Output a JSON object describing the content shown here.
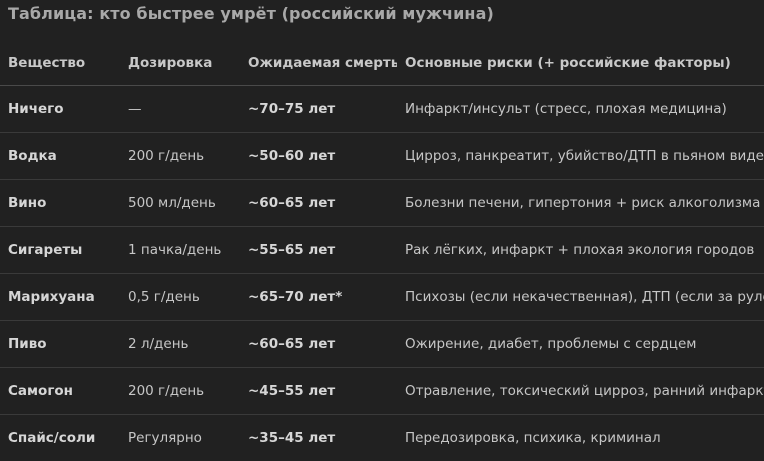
{
  "title": "Таблица: кто быстрее умрёт (российский мужчина)",
  "columns": [
    "Вещество",
    "Дозировка",
    "Ожидаемая смерть",
    "Основные риски (+ российские факторы)"
  ],
  "rows": [
    {
      "substance": "Ничего",
      "dose": "—",
      "death": "~70–75 лет",
      "risks": "Инфаркт/инсульт (стресс, плохая медицина)"
    },
    {
      "substance": "Водка",
      "dose": "200 г/день",
      "death": "~50–60 лет",
      "risks": "Цирроз, панкреатит, убийство/ДТП в пьяном виде"
    },
    {
      "substance": "Вино",
      "dose": "500 мл/день",
      "death": "~60–65 лет",
      "risks": "Болезни печени, гипертония + риск алкоголизма"
    },
    {
      "substance": "Сигареты",
      "dose": "1 пачка/день",
      "death": "~55–65 лет",
      "risks": "Рак лёгких, инфаркт + плохая экология городов"
    },
    {
      "substance": "Марихуана",
      "dose": "0,5 г/день",
      "death": "~65–70 лет*",
      "risks": "Психозы (если некачественная), ДТП (если за рулём)"
    },
    {
      "substance": "Пиво",
      "dose": "2 л/день",
      "death": "~60–65 лет",
      "risks": "Ожирение, диабет, проблемы с сердцем"
    },
    {
      "substance": "Самогон",
      "dose": "200 г/день",
      "death": "~45–55 лет",
      "risks": "Отравление, токсический цирроз, ранний инфаркт"
    },
    {
      "substance": "Спайс/соли",
      "dose": "Регулярно",
      "death": "~35–45 лет",
      "risks": "Передозировка, психика, криминал"
    }
  ]
}
